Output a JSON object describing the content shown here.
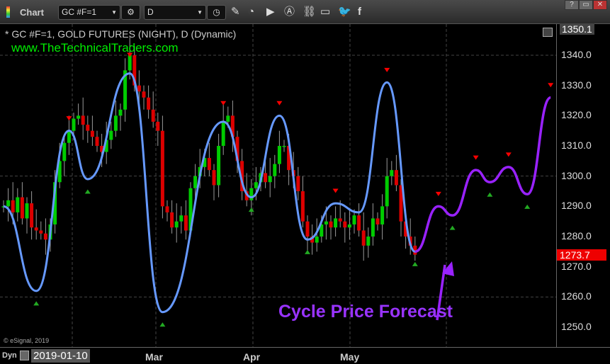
{
  "toolbar": {
    "app_label": "Chart",
    "symbol": "GC #F=1",
    "interval": "D",
    "icons": [
      "settings-icon",
      "clock-icon",
      "pencil-icon",
      "study-icon",
      "play-icon",
      "alert-icon",
      "link-icon",
      "comment-icon",
      "twitter-icon",
      "facebook-icon"
    ],
    "window_buttons": [
      "?",
      "▭",
      "✕"
    ]
  },
  "chart_header": {
    "title": "* GC #F=1, GOLD FUTURES (NIGHT), D (Dynamic)",
    "website": "www.TheTechnicalTraders.com",
    "copyright": "© eSignal, 2019"
  },
  "annotation": "Cycle Price Forecast",
  "bottom": {
    "mode": "Dyn",
    "start_date": "2019-01-10",
    "months": [
      "Mar",
      "Apr",
      "May"
    ]
  },
  "colors": {
    "up": "#00cc00",
    "down": "#dd0000",
    "cycle": "#6699ff",
    "forecast": "#9922ff",
    "price_tag": "#ee0000"
  },
  "chart_data": {
    "type": "line",
    "title": "GC #F=1, GOLD FUTURES (NIGHT), D",
    "ylim": [
      1245,
      1352
    ],
    "yticks": [
      1340,
      1330,
      1320,
      1310,
      1300,
      1290,
      1280,
      1270,
      1260,
      1250
    ],
    "ytick_labels": [
      "1340.0",
      "1330.0",
      "1320.0",
      "1310.0",
      "1300.0",
      "1290.0",
      "1280.0",
      "1270.0",
      "1260.0",
      "1250.0"
    ],
    "top_price": "1350.1",
    "last_price": "1273.7",
    "closes": [
      1290,
      1292,
      1288,
      1293,
      1286,
      1291,
      1283,
      1282,
      1281,
      1279,
      1284,
      1298,
      1305,
      1311,
      1315,
      1319,
      1320,
      1317,
      1315,
      1313,
      1310,
      1308,
      1312,
      1315,
      1320,
      1322,
      1335,
      1340,
      1330,
      1328,
      1326,
      1322,
      1318,
      1315,
      1290,
      1288,
      1283,
      1285,
      1287,
      1282,
      1296,
      1300,
      1303,
      1306,
      1302,
      1297,
      1310,
      1318,
      1320,
      1313,
      1305,
      1295,
      1292,
      1296,
      1298,
      1301,
      1298,
      1300,
      1304,
      1310,
      1310,
      1302,
      1300,
      1295,
      1285,
      1280,
      1278,
      1280,
      1284,
      1285,
      1283,
      1286,
      1285,
      1283,
      1284,
      1287,
      1282,
      1277,
      1280,
      1286,
      1284,
      1290,
      1300,
      1302,
      1297,
      1285,
      1280,
      1277,
      1274
    ],
    "cycle": [
      [
        0,
        1290
      ],
      [
        7,
        1262
      ],
      [
        14,
        1315
      ],
      [
        18,
        1299
      ],
      [
        27,
        1334
      ],
      [
        34,
        1255
      ],
      [
        47,
        1318
      ],
      [
        53,
        1293
      ],
      [
        59,
        1320
      ],
      [
        65,
        1279
      ],
      [
        71,
        1291
      ],
      [
        76,
        1288
      ],
      [
        82,
        1331
      ],
      [
        88,
        1275
      ]
    ],
    "forecast": [
      [
        88,
        1275
      ],
      [
        93,
        1290
      ],
      [
        96,
        1287
      ],
      [
        101,
        1302
      ],
      [
        104,
        1298
      ],
      [
        108,
        1303
      ],
      [
        112,
        1294
      ],
      [
        117,
        1326
      ]
    ],
    "peaks": [
      [
        14,
        1317
      ],
      [
        27,
        1338
      ],
      [
        47,
        1322
      ],
      [
        59,
        1322
      ],
      [
        71,
        1293
      ],
      [
        82,
        1333
      ],
      [
        93,
        1292
      ],
      [
        101,
        1304
      ],
      [
        108,
        1305
      ],
      [
        117,
        1328
      ]
    ],
    "troughs": [
      [
        7,
        1260
      ],
      [
        18,
        1297
      ],
      [
        34,
        1253
      ],
      [
        53,
        1291
      ],
      [
        65,
        1277
      ],
      [
        88,
        1273
      ],
      [
        96,
        1285
      ],
      [
        104,
        1296
      ],
      [
        112,
        1292
      ]
    ]
  }
}
